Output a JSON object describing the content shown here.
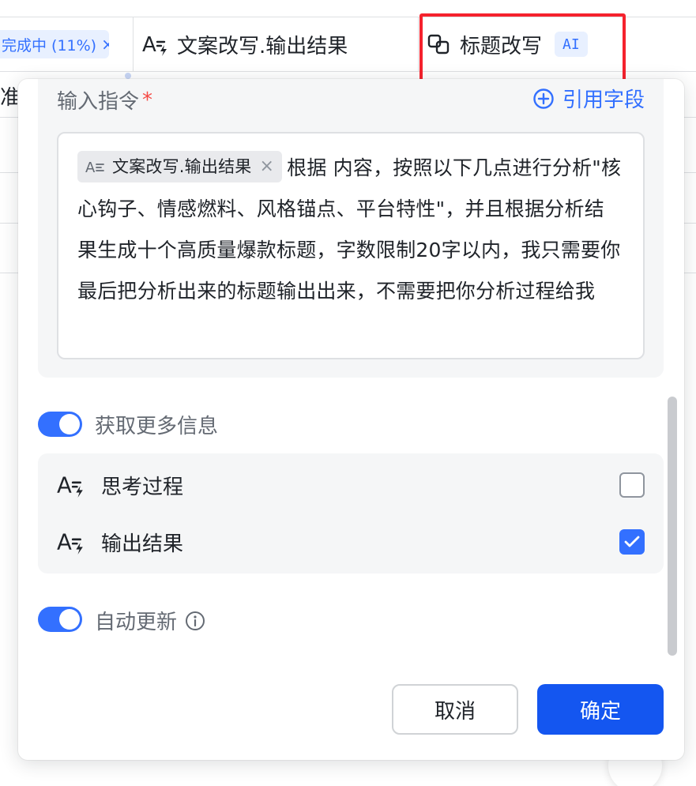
{
  "table": {
    "status_chip": {
      "text": "完成中 (11%)",
      "close": "×"
    },
    "columns": [
      {
        "label": "文案改写.输出结果",
        "icon": "text-lightning-icon"
      },
      {
        "label": "标题改写",
        "icon": "copy-link-icon",
        "badge": "AI"
      }
    ],
    "row_fragment": "准备"
  },
  "panel": {
    "instruction": {
      "label": "输入指令",
      "required_mark": "*",
      "ref_link": "引用字段",
      "tag": {
        "label": "文案改写.输出结果",
        "icon": "text-align-icon",
        "close": "×"
      },
      "text": "根据 内容，按照以下几点进行分析\"核心钩子、情感燃料、风格锚点、平台特性\"，并且根据分析结果生成十个高质量爆款标题，字数限制20字以内，我只需要你最后把分析出来的标题输出出来，不需要把你分析过程给我"
    },
    "more_info": {
      "label": "获取更多信息",
      "enabled": true,
      "options": [
        {
          "label": "思考过程",
          "checked": false,
          "icon": "text-lightning-icon"
        },
        {
          "label": "输出结果",
          "checked": true,
          "icon": "text-lightning-icon"
        }
      ]
    },
    "auto_update": {
      "label": "自动更新",
      "enabled": true,
      "icon": "info-icon"
    },
    "buttons": {
      "cancel": "取消",
      "ok": "确定"
    }
  },
  "colors": {
    "accent": "#3370ff",
    "primary_button": "#1456f0",
    "required": "#f54a45",
    "highlight_box": "#f5222d"
  }
}
